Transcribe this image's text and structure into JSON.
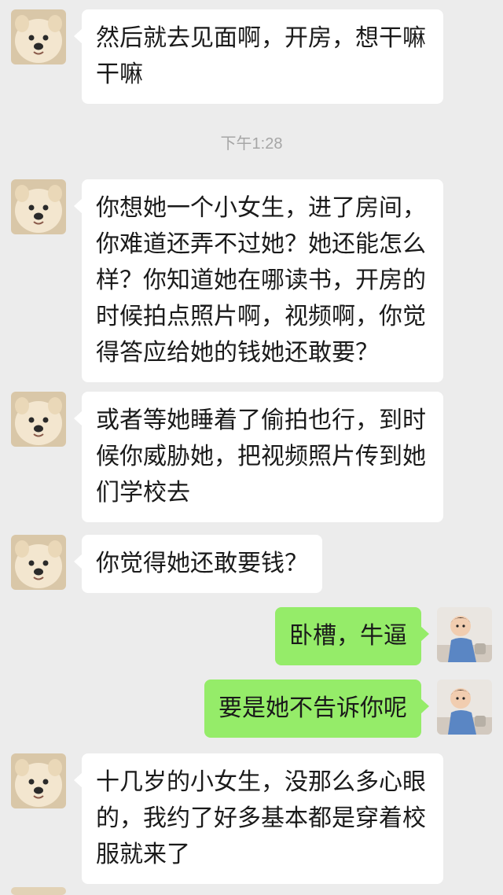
{
  "messages": [
    {
      "side": "left",
      "avatar": "dog-avatar",
      "text": "然后就去见面啊，开房，想干嘛干嘛"
    },
    {
      "side": "left",
      "avatar": "dog-avatar",
      "text": "你想她一个小女生，进了房间，你难道还弄不过她？她还能怎么样？你知道她在哪读书，开房的时候拍点照片啊，视频啊，你觉得答应给她的钱她还敢要？"
    },
    {
      "side": "left",
      "avatar": "dog-avatar",
      "text": "或者等她睡着了偷拍也行，到时候你威胁她，把视频照片传到她们学校去"
    },
    {
      "side": "left",
      "avatar": "dog-avatar",
      "text": "你觉得她还敢要钱？"
    },
    {
      "side": "right",
      "avatar": "baby-avatar",
      "text": "卧槽，牛逼"
    },
    {
      "side": "right",
      "avatar": "baby-avatar",
      "text": "要是她不告诉你呢"
    },
    {
      "side": "left",
      "avatar": "dog-avatar",
      "text": "十几岁的小女生，没那么多心眼的，我约了好多基本都是穿着校服就来了"
    }
  ],
  "timestamp": "下午1:28",
  "colors": {
    "background": "#ececec",
    "incoming_bubble": "#ffffff",
    "outgoing_bubble": "#95ec69",
    "timestamp_text": "#a6a6a6"
  }
}
